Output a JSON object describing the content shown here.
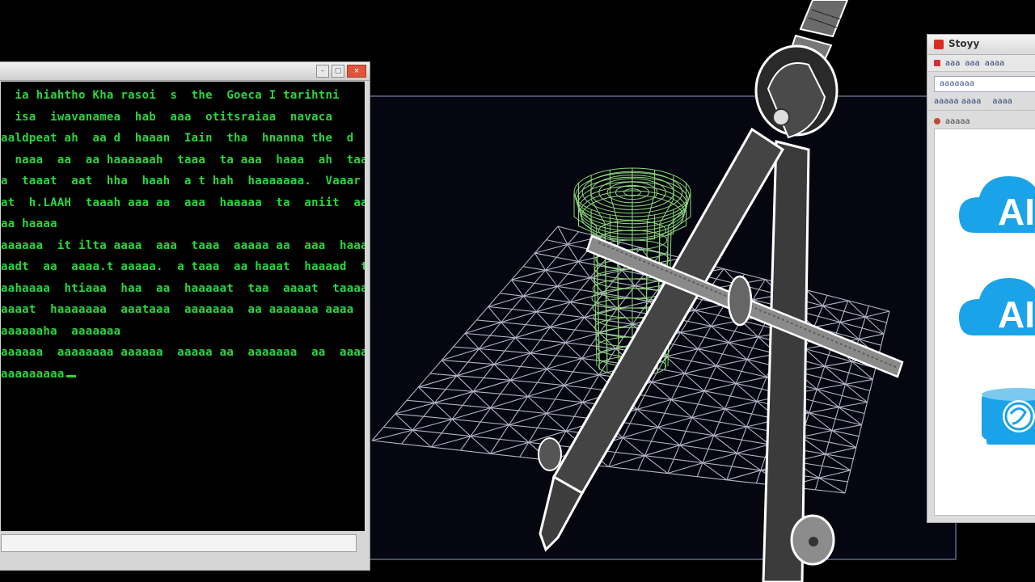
{
  "terminal": {
    "close_label": "×",
    "minimize_label": "–",
    "maximize_label": "▢",
    "lines": [
      "  ia hiahtho Kha rasoi  s  the  Goeca I tarihtni",
      "  isa  iwavanamea  hab  aaa  otitsraiaa  navaca",
      "aaldpeat ah  aa d  haaan  Iain  tha  hnanna the  d",
      "  naaa  aa  aa haaaaaah  taaa  ta aaa  haaa  ah  taa",
      "a  taaat  aat  hha  haah  a t hah  haaaaaaa.  Vaaar  iaa",
      "at  h.LAAH  taaah aaa aa  aaa  haaaaa  ta  aniit  aa",
      "aa haaaa",
      "aaaaaa  it ilta aaaa  aaa  taaa  aaaaa aa  aaa  haaaaa",
      "aadt  aa  aaaa.t aaaaa.  a taaa  aa haaat  haaaad  ta",
      "aahaaaa  htiaaa  haa  aa  haaaaat  taa  aaaat  taaaaa",
      "aaaat  haaaaaaa  aaataaa  aaaaaaa  aa aaaaaaa aaaa  ta",
      "aaaaaaha  aaaaaaa",
      "aaaaaa  aaaaaaaa aaaaaa  aaaaa aa  aaaaaaa  aa  aaaaa",
      "aaaaaaaaa"
    ]
  },
  "browser": {
    "title": "Stoyy",
    "tabs": [
      "aaa",
      "aaa",
      "aaaa"
    ],
    "address_text": "aaaaaaa",
    "bookmarks": [
      "aaaaa aaaa",
      "aaaa"
    ],
    "page_tab": "aaaaa",
    "cloud_labels": [
      "AI",
      "AI"
    ],
    "accent_color": "#1aa3e8"
  },
  "colors": {
    "terminal_text": "#29d63c",
    "mesh_cylinder": "#8fd67a",
    "mesh_plane": "#cfd3e6",
    "compass_body": "#3a3a3a"
  }
}
